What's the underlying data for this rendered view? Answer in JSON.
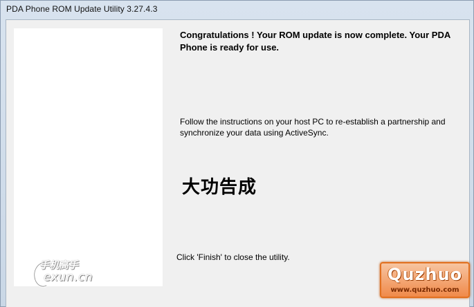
{
  "window": {
    "title": "PDA Phone ROM Update Utility 3.27.4.3"
  },
  "content": {
    "heading": "Congratulations ! Your ROM update is now complete. Your PDA Phone is ready for use.",
    "instructions": "Follow the instructions on your host PC to re-establish a partnership and synchronize your data using ActiveSync.",
    "overlay_text": "大功告成",
    "finish_text": "Click 'Finish' to close the utility."
  },
  "watermarks": {
    "left_cn": "手机高手",
    "left_en": "exun.cn",
    "right_brand": "Quzhuo",
    "right_url": "www.quzhuo.com"
  },
  "colors": {
    "client_bg": "#f0f0f0",
    "panel_bg": "#ffffff",
    "watermark_orange": "#f08a4a"
  }
}
